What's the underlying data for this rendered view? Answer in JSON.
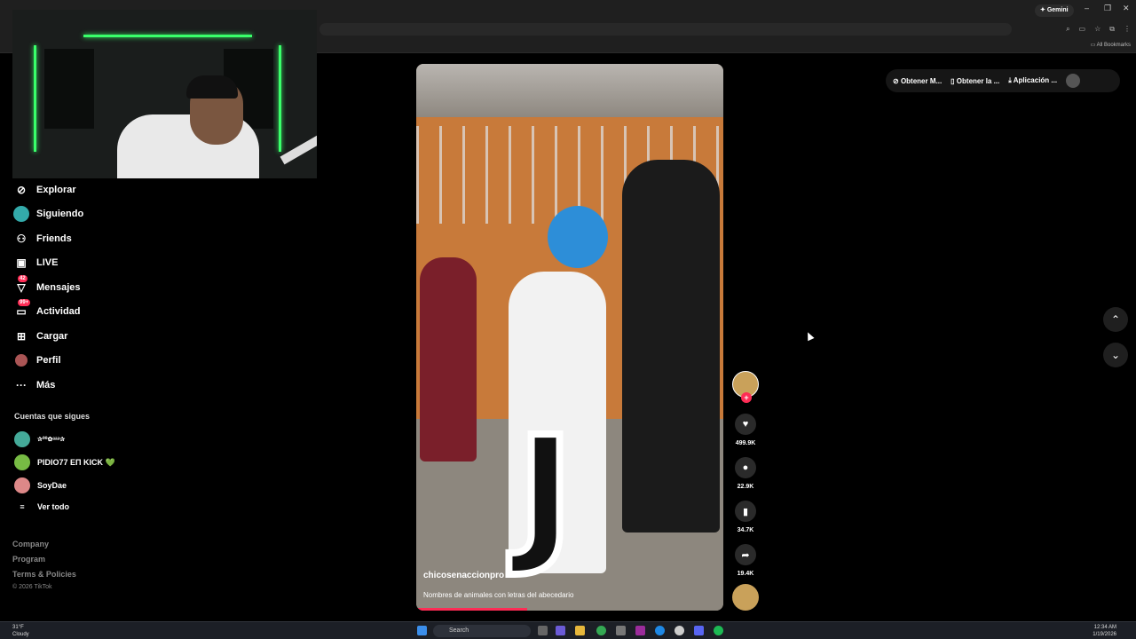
{
  "browser": {
    "gemini_label": "Gemini",
    "all_bookmarks": "All Bookmarks"
  },
  "sidebar": {
    "items": [
      {
        "label": "Explorar",
        "icon": "compass-icon"
      },
      {
        "label": "Siguiendo",
        "icon": "avatar-icon"
      },
      {
        "label": "Friends",
        "icon": "friends-icon"
      },
      {
        "label": "LIVE",
        "icon": "live-icon"
      },
      {
        "label": "Mensajes",
        "icon": "messages-icon",
        "badge": "42"
      },
      {
        "label": "Actividad",
        "icon": "activity-icon",
        "badge": "99+"
      },
      {
        "label": "Cargar",
        "icon": "upload-icon"
      },
      {
        "label": "Perfil",
        "icon": "profile-icon"
      },
      {
        "label": "Más",
        "icon": "more-icon"
      }
    ],
    "following_title": "Cuentas que sigues",
    "following": [
      {
        "name": "✰⁰⁰✿ᵃᵃᵃ✰"
      },
      {
        "name": "ΡIDIO77 EΠ KICK 💚"
      },
      {
        "name": "SoyDae"
      }
    ],
    "see_all": "Ver todo",
    "footer": [
      "Company",
      "Program",
      "Terms & Policies"
    ],
    "copyright": "© 2026 TikTok"
  },
  "video": {
    "username": "chicosenaccionpro",
    "description": "Nombres de animales con letras del abecedario",
    "overlay_letter": "J",
    "progress_fraction": 0.36
  },
  "actions": {
    "likes": "499.9K",
    "comments": "22.9K",
    "saves": "34.7K",
    "shares": "19.4K"
  },
  "top_links": {
    "get_music": "Obtener M...",
    "get_app": "Obtener la ...",
    "desktop_app": "Aplicación ..."
  },
  "taskbar": {
    "temperature": "31°F",
    "weather": "Cloudy",
    "search": "Search",
    "time": "12:34 AM",
    "date": "1/19/2026"
  },
  "colors": {
    "accent": "#fe2c55",
    "background": "#000000"
  }
}
